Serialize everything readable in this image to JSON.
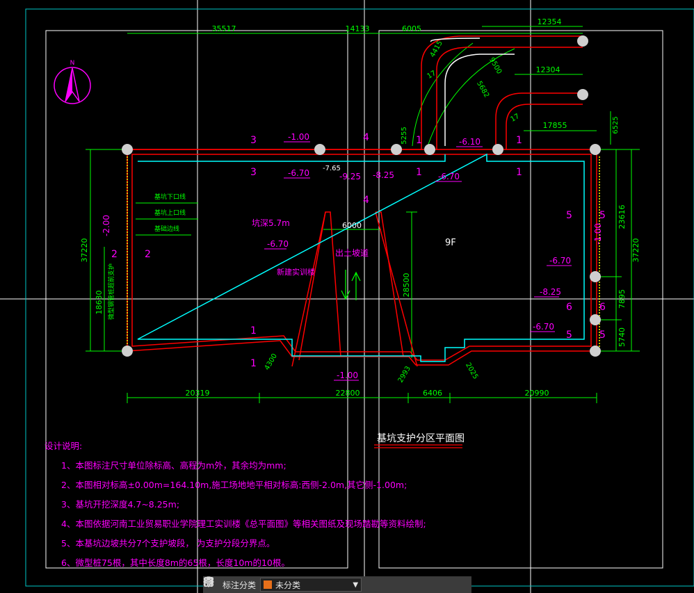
{
  "drawing": {
    "title": "基坑支护分区平面图",
    "north_label": "N",
    "building_label": "9F",
    "building_name": "新建实训楼",
    "depth_label": "坑深5.7m",
    "ramp_label": "出土坡道",
    "legend": [
      "基坑下口线",
      "基坑上口线",
      "基础边线"
    ],
    "vertical_label": "微型钢管桩超前支护",
    "top_dims": [
      "35517",
      "14133",
      "6005",
      "12354",
      "12304",
      "17855"
    ],
    "bottom_dims": [
      "20319",
      "22800",
      "6406",
      "20990"
    ],
    "left_dims": [
      "37220",
      "18630"
    ],
    "right_dims": [
      "23616",
      "37220",
      "7895",
      "5740"
    ],
    "misc_dims": [
      "5255",
      "6000",
      "28500",
      "4415",
      "9500",
      "5682",
      "17",
      "17",
      "6525",
      "4300",
      "2993",
      "2025"
    ],
    "elevations": [
      "-1.00",
      "-6.70",
      "-7.65",
      "-9.25",
      "-8.25",
      "-6.10",
      "-6.70",
      "-2.00",
      "-6.70",
      "-6.70",
      "-8.25",
      "-6.70",
      "-1.00",
      "-1.00"
    ],
    "section_marks": [
      "3",
      "3",
      "4",
      "4",
      "1",
      "1",
      "1",
      "1",
      "2",
      "2",
      "5",
      "5",
      "6",
      "6",
      "5",
      "5",
      "1",
      "1"
    ],
    "notes_title": "设计说明:",
    "notes": [
      "1、本图标注尺寸单位除标高、高程为m外，其余均为mm;",
      "2、本图相对标高±0.00m=164.10m,施工场地地平相对标高:西侧-2.0m,其它侧-1.00m;",
      "3、基坑开挖深度4.7~8.25m;",
      "4、本图依据河南工业贸易职业学院理工实训楼《总平面图》等相关图纸及现场踏勘等资料绘制;",
      "5、本基坑边坡共分7个支护坡段，    为支护分段分界点。",
      "6、微型桩75根，其中长度8m的65根，长度10m的10根。"
    ]
  },
  "toolbar": {
    "label": "标注分类",
    "selected": "未分类"
  },
  "colors": {
    "background": "#000000",
    "red": "#ff0000",
    "magenta": "#ff00ff",
    "green": "#00ff00",
    "cyan": "#00ffff",
    "white": "#ffffff",
    "yellow": "#ffff00"
  }
}
